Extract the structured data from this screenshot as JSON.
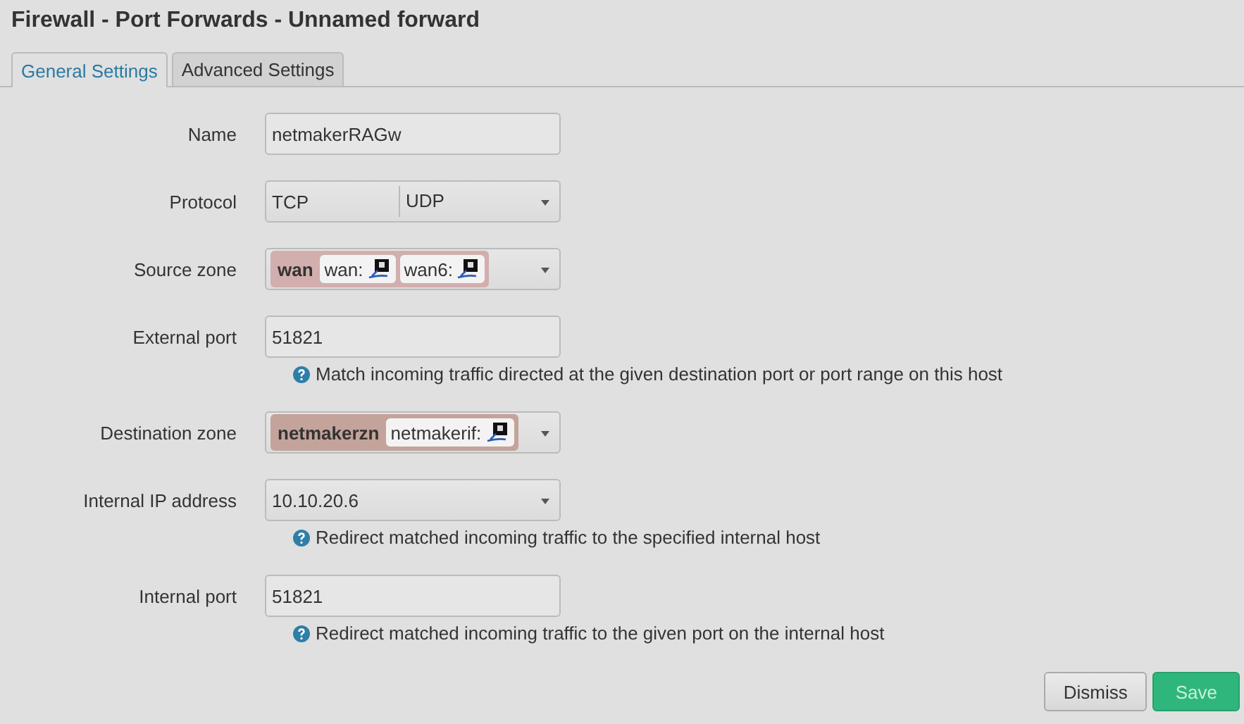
{
  "title": "Firewall - Port Forwards - Unnamed forward",
  "tabs": [
    {
      "label": "General Settings",
      "selected": true
    },
    {
      "label": "Advanced Settings",
      "selected": false
    }
  ],
  "fields": [
    {
      "kind": "text",
      "label": "Name",
      "value": "netmakerRAGw"
    },
    {
      "kind": "multi",
      "label": "Protocol",
      "values": [
        "TCP",
        "UDP"
      ]
    },
    {
      "kind": "zone",
      "label": "Source zone",
      "zone": "wan",
      "color": "#d2aeae",
      "networks": [
        "wan:",
        "wan6:"
      ]
    },
    {
      "kind": "text",
      "label": "External port",
      "value": "51821",
      "help": "Match incoming traffic directed at the given destination port or port range on this host"
    },
    {
      "kind": "zone",
      "label": "Destination zone",
      "zone": "netmakerzn",
      "color": "#c4a39b",
      "networks": [
        "netmakerif:"
      ]
    },
    {
      "kind": "select",
      "label": "Internal IP address",
      "value": "10.10.20.6",
      "help": "Redirect matched incoming traffic to the specified internal host"
    },
    {
      "kind": "text",
      "label": "Internal port",
      "value": "51821",
      "help": "Redirect matched incoming traffic to the given port on the internal host"
    }
  ],
  "buttons": [
    {
      "kind": "plain",
      "label": "Dismiss"
    },
    {
      "kind": "primary",
      "label": "Save"
    }
  ]
}
